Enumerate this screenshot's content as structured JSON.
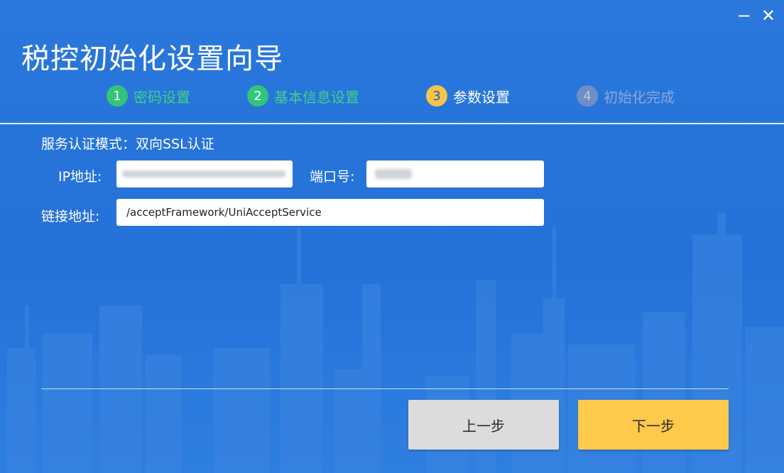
{
  "window": {
    "title": "税控初始化设置向导",
    "minimize_glyph": "−",
    "close_glyph": "✕"
  },
  "steps": [
    {
      "number": "1",
      "label": "密码设置",
      "state": "done"
    },
    {
      "number": "2",
      "label": "基本信息设置",
      "state": "done"
    },
    {
      "number": "3",
      "label": "参数设置",
      "state": "active"
    },
    {
      "number": "4",
      "label": "初始化完成",
      "state": "todo"
    }
  ],
  "form": {
    "auth_mode_text": "服务认证模式：双向SSL认证",
    "ip_label": "IP地址:",
    "port_label": "端口号:",
    "link_label": "链接地址:",
    "link_value": "/acceptFramework/UniAcceptService"
  },
  "buttons": {
    "prev_label": "上一步",
    "next_label": "下一步"
  },
  "colors": {
    "background": "#2471d8",
    "step_done": "#33c57a",
    "step_active": "#f7c34a",
    "next_button": "#ffc94a",
    "prev_button": "#dcdcdc"
  }
}
